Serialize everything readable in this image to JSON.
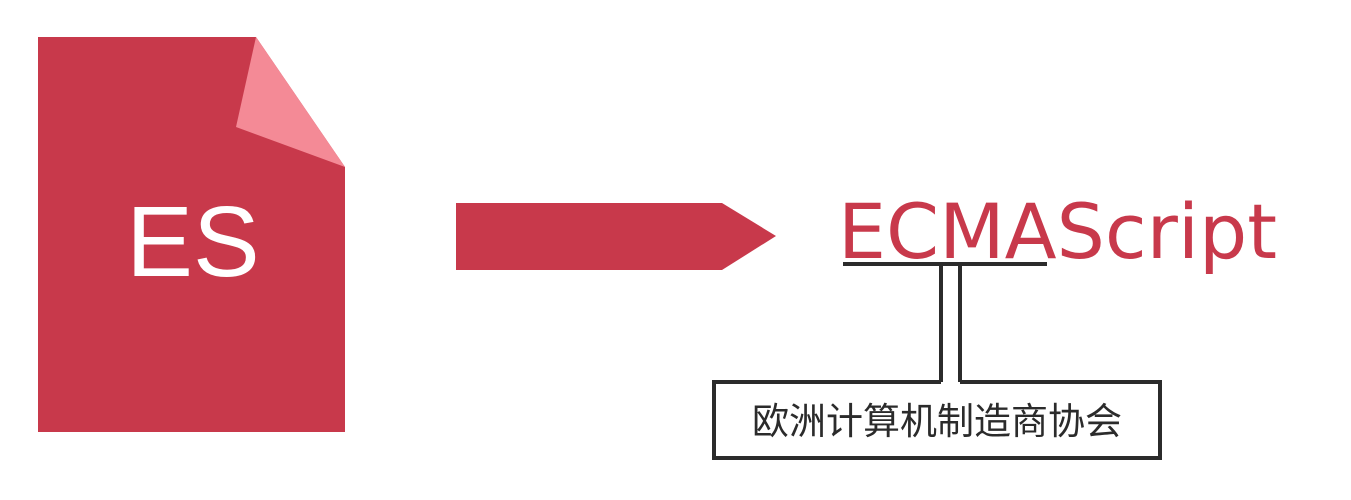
{
  "file_icon": {
    "label": "ES",
    "color": "#c8394b",
    "fold_color": "#f48a96"
  },
  "arrow": {
    "color": "#c8394b"
  },
  "term": {
    "text": "ECMAScript",
    "underlined_part": "ECMA",
    "color": "#c8394b"
  },
  "annotation": {
    "text": "欧洲计算机制造商协会",
    "line_color": "#2b2b2b"
  }
}
